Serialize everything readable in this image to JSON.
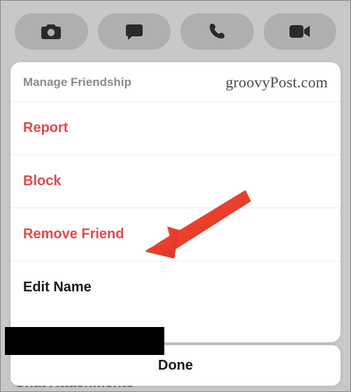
{
  "toolbar": {
    "icons": [
      "camera-icon",
      "chat-icon",
      "phone-icon",
      "video-icon"
    ]
  },
  "sheet": {
    "title": "Manage Friendship",
    "watermark": "groovyPost.com",
    "items": [
      {
        "label": "Report",
        "style": "danger"
      },
      {
        "label": "Block",
        "style": "danger"
      },
      {
        "label": "Remove Friend",
        "style": "danger"
      },
      {
        "label": "Edit Name",
        "style": "normal"
      }
    ]
  },
  "done": {
    "label": "Done"
  },
  "background_peek": "Chat Attachments",
  "annotation": {
    "arrow_color": "#f0402a",
    "points_to": "Remove Friend"
  }
}
